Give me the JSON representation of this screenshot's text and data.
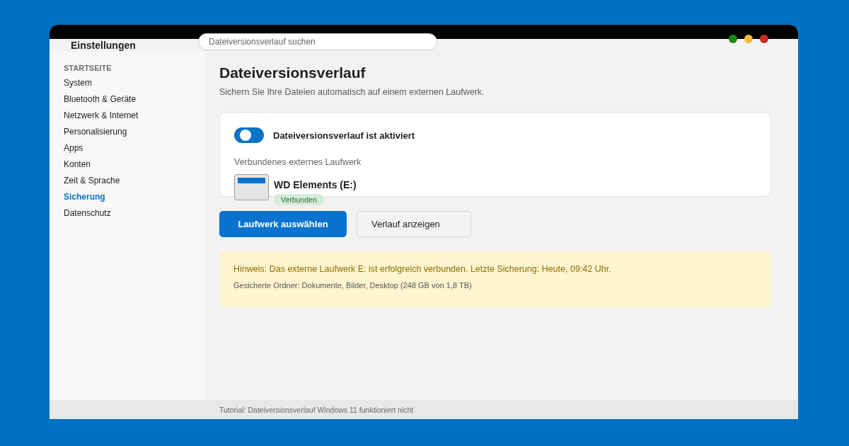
{
  "window": {
    "title": "Einstellungen",
    "controls": [
      {
        "color": "#168a16"
      },
      {
        "color": "#f5b93e"
      },
      {
        "color": "#c62f24"
      }
    ]
  },
  "search": {
    "placeholder": "Dateiversionsverlauf suchen"
  },
  "sidebar": {
    "heading": "STARTSEITE",
    "items": [
      {
        "label": "System",
        "selected": false
      },
      {
        "label": "Bluetooth & Geräte",
        "selected": false
      },
      {
        "label": "Netzwerk & Internet",
        "selected": false
      },
      {
        "label": "Personalisierung",
        "selected": false
      },
      {
        "label": "Apps",
        "selected": false
      },
      {
        "label": "Konten",
        "selected": false
      },
      {
        "label": "Zeit & Sprache",
        "selected": false
      },
      {
        "label": "Sicherung",
        "selected": true
      },
      {
        "label": "Datenschutz",
        "selected": false
      }
    ]
  },
  "page": {
    "title": "Dateiversionsverlauf",
    "subtitle": "Sichern Sie Ihre Dateien automatisch auf einem externen Laufwerk."
  },
  "card": {
    "toggle": {
      "on": true,
      "label": "Dateiversionsverlauf ist aktiviert"
    },
    "drive_label": "Verbundenes externes Laufwerk",
    "drive": {
      "name": "WD Elements (E:)",
      "status": "Verbunden"
    }
  },
  "buttons": [
    {
      "label": "Laufwerk auswählen",
      "kind": "primary"
    },
    {
      "label": "Verlauf anzeigen",
      "kind": "secondary"
    }
  ],
  "notice": {
    "text": "Hinweis: Das externe Laufwerk E: ist erfolgreich verbunden. Letzte Sicherung: Heute, 09:42 Uhr.",
    "detail": "Gesicherte Ordner: Dokumente, Bilder, Desktop (248 GB von 1,8 TB)"
  },
  "status_bar": {
    "text": "Tutorial: Dateiversionsverlauf Windows 11 funktioniert nicht"
  }
}
